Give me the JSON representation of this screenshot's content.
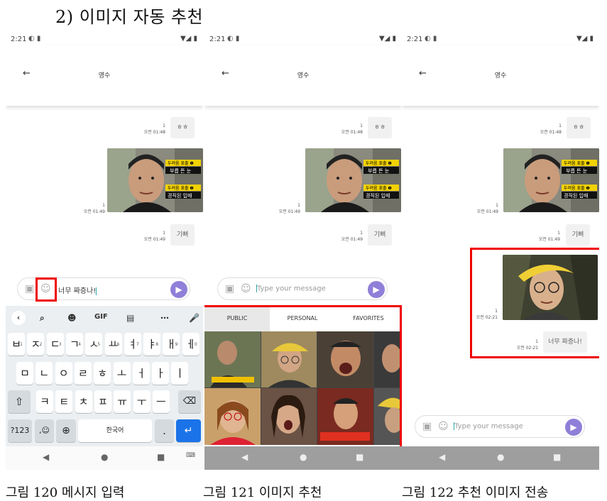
{
  "heading": "2) 이미지 자동 추천",
  "captions": [
    "그림 120 메시지 입력",
    "그림 121 이미지 추천",
    "그림 122 추천 이미지 전송"
  ],
  "status": {
    "time": "2:21"
  },
  "chat": {
    "title": "영수",
    "back_icon": "arrow-left-icon",
    "msg1": {
      "text": "ㅎㅎ",
      "count": "1",
      "time": "오전 01:48"
    },
    "msg2": {
      "count": "1",
      "time": "오전 01:49",
      "caption1": "두려움 표출 ❶",
      "caption2": "부릅 뜬 눈",
      "caption3": "두려움 표출 ❷",
      "caption4": "경직된 입매"
    },
    "msg3": {
      "text": "기뻐",
      "count": "1",
      "time": "오전 01:49"
    }
  },
  "phone1": {
    "input_text": "너무 짜증나!"
  },
  "phone2": {
    "input_placeholder": "Type your message"
  },
  "phone3": {
    "sent_image": {
      "count": "1",
      "time": "오전 02:21"
    },
    "sent_text": {
      "text": "너무 짜증나!",
      "count": "1",
      "time": "오전 02:21"
    },
    "input_placeholder": "Type your message"
  },
  "keyboard": {
    "toolbar": [
      "<",
      "search",
      "sticker",
      "GIF",
      "clipboard",
      "...",
      "mic"
    ],
    "gif_label": "GIF",
    "row1": [
      {
        "k": "ㅂ",
        "n": "1"
      },
      {
        "k": "ㅈ",
        "n": "2"
      },
      {
        "k": "ㄷ",
        "n": "3"
      },
      {
        "k": "ㄱ",
        "n": "4"
      },
      {
        "k": "ㅅ",
        "n": "5"
      },
      {
        "k": "ㅛ",
        "n": "6"
      },
      {
        "k": "ㅕ",
        "n": "7"
      },
      {
        "k": "ㅑ",
        "n": "8"
      },
      {
        "k": "ㅐ",
        "n": "9"
      },
      {
        "k": "ㅔ",
        "n": "0"
      }
    ],
    "row2": [
      "ㅁ",
      "ㄴ",
      "ㅇ",
      "ㄹ",
      "ㅎ",
      "ㅗ",
      "ㅓ",
      "ㅏ",
      "ㅣ"
    ],
    "row3": [
      "ㅋ",
      "ㅌ",
      "ㅊ",
      "ㅍ",
      "ㅠ",
      "ㅜ",
      "ㅡ"
    ],
    "sym_key": "?123",
    "space_label": "한국어",
    "period": "."
  },
  "recommend": {
    "tabs": [
      "PUBLIC",
      "PERSONAL",
      "FAVORITES"
    ]
  },
  "colors": {
    "send": "#8f7fd8",
    "highlight": "#e00000",
    "enter": "#1a73e8"
  }
}
